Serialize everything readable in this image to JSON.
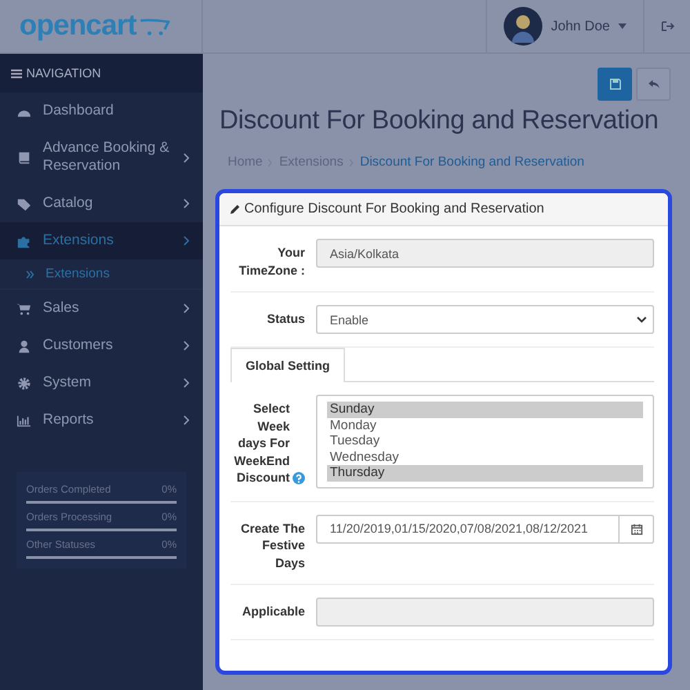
{
  "header": {
    "logo": "opencart",
    "user_name": "John Doe"
  },
  "navigation": {
    "title": "NAVIGATION",
    "items": [
      {
        "kind": "dashboard",
        "label": "Dashboard",
        "has_children": false,
        "selected": false
      },
      {
        "kind": "book",
        "label": "Advance Booking & Reservation",
        "has_children": true,
        "selected": false
      },
      {
        "kind": "tag",
        "label": "Catalog",
        "has_children": true,
        "selected": false
      },
      {
        "kind": "puzzle",
        "label": "Extensions",
        "has_children": true,
        "selected": true,
        "children": [
          {
            "label": "Extensions",
            "selected": true
          }
        ]
      },
      {
        "kind": "cart",
        "label": "Sales",
        "has_children": true,
        "selected": false
      },
      {
        "kind": "user",
        "label": "Customers",
        "has_children": true,
        "selected": false
      },
      {
        "kind": "gear",
        "label": "System",
        "has_children": true,
        "selected": false
      },
      {
        "kind": "chart",
        "label": "Reports",
        "has_children": true,
        "selected": false
      }
    ]
  },
  "stats": [
    {
      "label": "Orders Completed",
      "value": "0%",
      "level": 0
    },
    {
      "label": "Orders Processing",
      "value": "0%",
      "level": 0
    },
    {
      "label": "Other Statuses",
      "value": "0%",
      "level": 0
    }
  ],
  "page": {
    "title": "Discount For Booking and Reservation",
    "breadcrumbs": [
      {
        "label": "Home",
        "selected": false
      },
      {
        "label": "Extensions",
        "selected": false
      },
      {
        "label": "Discount For Booking and Reservation",
        "selected": true
      }
    ]
  },
  "form": {
    "title": "Configure Discount For Booking and Reservation",
    "rows": [
      {
        "kind": "text",
        "label": "Your TimeZone :",
        "value": "Asia/Kolkata",
        "disabled": true
      },
      {
        "kind": "select",
        "label": "Status",
        "value": "Enable",
        "disabled": false
      }
    ],
    "tabs": [
      {
        "label": "Global Setting",
        "selected": true
      }
    ],
    "tab_rows": [
      {
        "kind": "multiselect",
        "label": "Select Week days For WeekEnd Discount",
        "help": true,
        "options": [
          {
            "label": "Sunday",
            "selected": true
          },
          {
            "label": "Monday",
            "selected": false
          },
          {
            "label": "Tuesday",
            "selected": false
          },
          {
            "label": "Wednesday",
            "selected": false
          },
          {
            "label": "Thursday",
            "selected": true
          }
        ]
      },
      {
        "kind": "date",
        "label": "Create The Festive Days",
        "value": "11/20/2019,01/15/2020,07/08/2021,08/12/2021",
        "disabled": false
      },
      {
        "kind": "text",
        "label": "Applicable",
        "disabled": true
      }
    ]
  }
}
